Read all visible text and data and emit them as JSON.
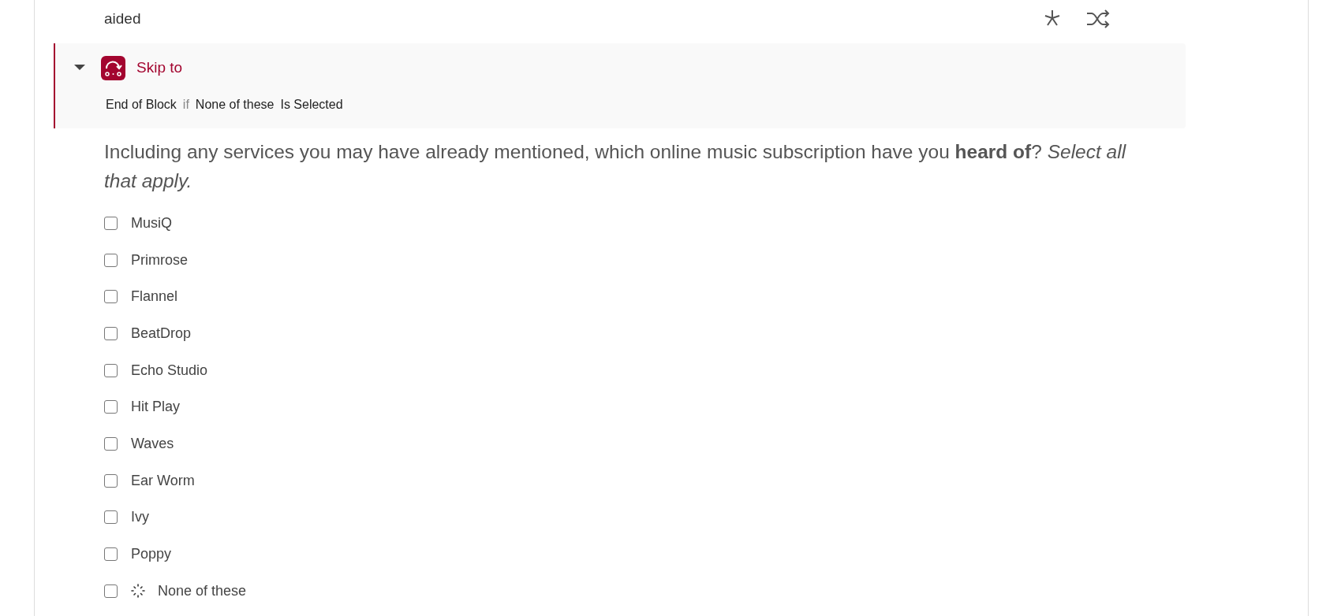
{
  "question_id": "aided",
  "skip_logic": {
    "expanded": true,
    "title": "Skip to",
    "target": "End of Block",
    "connector": "if",
    "choice": "None of these",
    "condition": "Is Selected"
  },
  "question": {
    "text": "Including any services you may have already mentioned, which online music subscription have you **heard of**? *Select all that apply.*",
    "options": [
      {
        "label": "MusiQ",
        "checked": false,
        "exclusive": false
      },
      {
        "label": "Primrose",
        "checked": false,
        "exclusive": false
      },
      {
        "label": "Flannel",
        "checked": false,
        "exclusive": false
      },
      {
        "label": "BeatDrop",
        "checked": false,
        "exclusive": false
      },
      {
        "label": "Echo Studio",
        "checked": false,
        "exclusive": false
      },
      {
        "label": "Hit Play",
        "checked": false,
        "exclusive": false
      },
      {
        "label": "Waves",
        "checked": false,
        "exclusive": false
      },
      {
        "label": "Ear Worm",
        "checked": false,
        "exclusive": false
      },
      {
        "label": "Ivy",
        "checked": false,
        "exclusive": false
      },
      {
        "label": "Poppy",
        "checked": false,
        "exclusive": false
      },
      {
        "label": "None of these",
        "checked": false,
        "exclusive": true
      }
    ]
  }
}
